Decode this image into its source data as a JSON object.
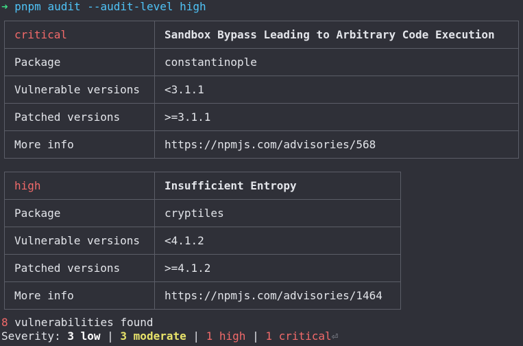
{
  "terminal": {
    "prompt_symbol": "➜",
    "command": "pnpm audit --audit-level high"
  },
  "advisories": [
    {
      "severity": "critical",
      "title": "Sandbox Bypass Leading to Arbitrary Code Execution",
      "rows": [
        {
          "label": "Package",
          "value": "constantinople"
        },
        {
          "label": "Vulnerable versions",
          "value": "<3.1.1"
        },
        {
          "label": "Patched versions",
          "value": ">=3.1.1"
        },
        {
          "label": "More info",
          "value": "https://npmjs.com/advisories/568"
        }
      ]
    },
    {
      "severity": "high",
      "title": "Insufficient Entropy",
      "rows": [
        {
          "label": "Package",
          "value": "cryptiles"
        },
        {
          "label": "Vulnerable versions",
          "value": "<4.1.2"
        },
        {
          "label": "Patched versions",
          "value": ">=4.1.2"
        },
        {
          "label": "More info",
          "value": "https://npmjs.com/advisories/1464"
        }
      ]
    }
  ],
  "summary": {
    "count": "8",
    "found_text": " vulnerabilities found",
    "severity_label": "Severity: ",
    "low": "3 low",
    "moderate": "3 moderate",
    "high": "1 high",
    "critical": "1 critical",
    "separator": " | ",
    "return_mark": "⏎"
  },
  "colors": {
    "background": "#2f3038",
    "prompt_arrow": "#3ddc84",
    "command": "#4fc3f7",
    "severity_red": "#f26a6a",
    "moderate_yellow": "#e8e36a",
    "border": "#5c5e68"
  }
}
